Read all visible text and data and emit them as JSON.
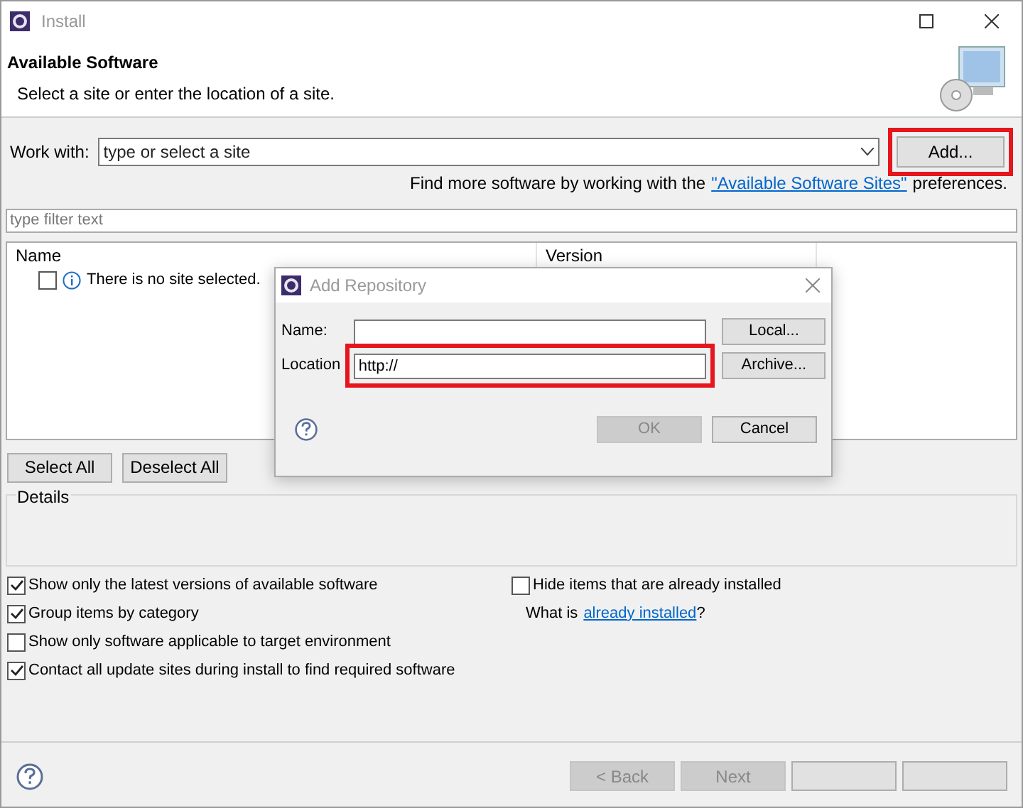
{
  "window": {
    "title": "Install"
  },
  "header": {
    "title": "Available Software",
    "subtitle": "Select a site or enter the location of a site."
  },
  "work_with": {
    "label": "Work with:",
    "placeholder": "type or select a site",
    "button": "Add...",
    "highlighted": true
  },
  "more_software": {
    "text": "Find more software by working with the",
    "link": "\"Available Software Sites\"",
    "suffix": "preferences."
  },
  "filter": {
    "placeholder": "type filter text"
  },
  "table": {
    "columns": [
      "Name",
      "Version"
    ],
    "rows": [
      {
        "text": "There is no site selected.",
        "checked": false
      }
    ]
  },
  "selection_buttons": [
    "Select All",
    "Deselect All"
  ],
  "details": {
    "label": "Details"
  },
  "options_left": [
    {
      "label": "Show only the latest versions of available software",
      "checked": true
    },
    {
      "label": "Group items by category",
      "checked": true
    },
    {
      "label": "Show only software applicable to target environment",
      "checked": false
    },
    {
      "label": "Contact all update sites during install to find required software",
      "checked": true
    }
  ],
  "options_right": [
    {
      "label": "Hide items that are already installed",
      "checked": false
    }
  ],
  "installed_hint": {
    "prefix": "What is",
    "link": "already installed",
    "suffix": "?"
  },
  "footer_buttons": [
    {
      "label": "< Back",
      "disabled": true
    },
    {
      "label": "Next",
      "disabled": true
    }
  ],
  "dialog": {
    "title": "Add Repository",
    "fields": [
      {
        "label": "Name:",
        "button": "Local...",
        "highlighted": false
      },
      {
        "label": "Location",
        "value": "http://",
        "button": "Archive...",
        "highlighted": true
      }
    ],
    "buttons": [
      {
        "label": "OK",
        "disabled": true
      },
      {
        "label": "Cancel",
        "disabled": false
      }
    ]
  }
}
